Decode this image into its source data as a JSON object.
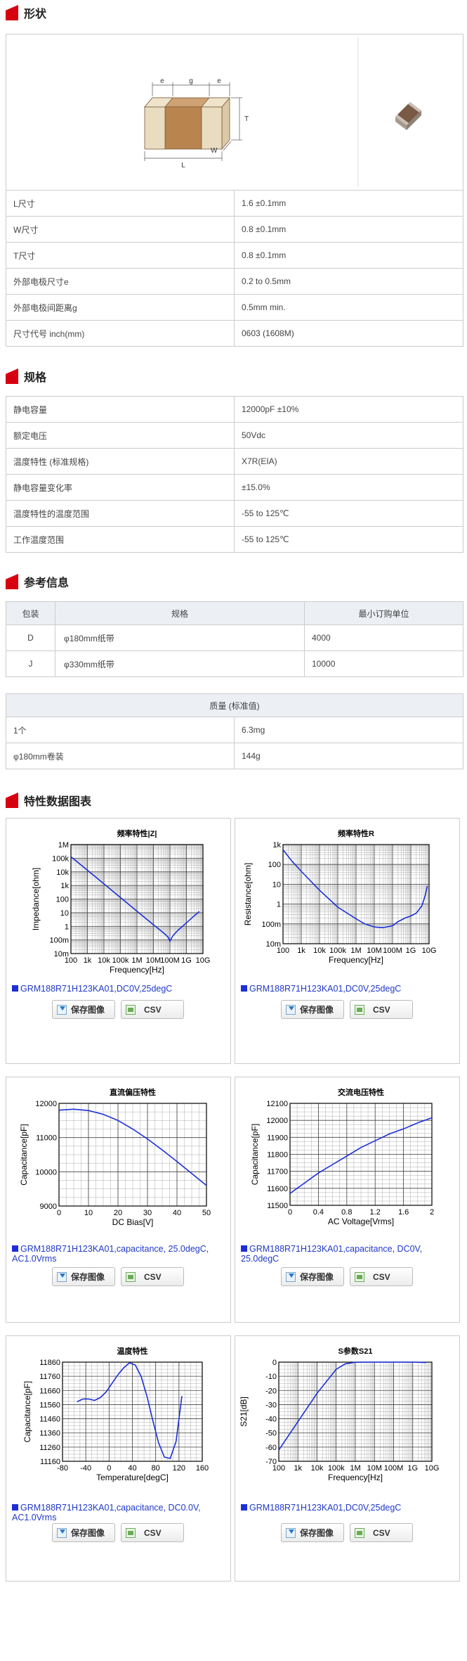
{
  "sections": {
    "shape": "形状",
    "spec": "规格",
    "ref": "参考信息",
    "charts": "特性数据图表"
  },
  "diagram": {
    "labels": {
      "e1": "e",
      "g": "g",
      "e2": "e",
      "T": "T",
      "W": "W",
      "L": "L"
    },
    "colors": {
      "body": "#b9844e",
      "electrode": "#e9dcc0",
      "photo_body": "#7a5a44"
    }
  },
  "shape_rows": [
    {
      "k": "L尺寸",
      "v": "1.6 ±0.1mm"
    },
    {
      "k": "W尺寸",
      "v": "0.8 ±0.1mm"
    },
    {
      "k": "T尺寸",
      "v": "0.8 ±0.1mm"
    },
    {
      "k": "外部电极尺寸e",
      "v": "0.2 to 0.5mm"
    },
    {
      "k": "外部电极间距离g",
      "v": "0.5mm min."
    },
    {
      "k": "尺寸代号 inch(mm)",
      "v": "0603 (1608M)"
    }
  ],
  "spec_rows": [
    {
      "k": "静电容量",
      "v": "12000pF ±10%"
    },
    {
      "k": "额定电压",
      "v": "50Vdc"
    },
    {
      "k": "温度特性 (标准规格)",
      "v": "X7R(EIA)"
    },
    {
      "k": "静电容量变化率",
      "v": "±15.0%"
    },
    {
      "k": "温度特性的温度范围",
      "v": "-55 to 125℃"
    },
    {
      "k": "工作温度范围",
      "v": "-55 to 125℃"
    }
  ],
  "pack": {
    "headers": [
      "包装",
      "规格",
      "最小订购单位"
    ],
    "rows": [
      {
        "a": "D",
        "b": "φ180mm纸带",
        "c": "4000"
      },
      {
        "a": "J",
        "b": "φ330mm纸带",
        "c": "10000"
      }
    ]
  },
  "mass": {
    "header": "质量 (标准值)",
    "rows": [
      {
        "k": "1个",
        "v": "6.3mg"
      },
      {
        "k": "φ180mm卷装",
        "v": "144g"
      }
    ]
  },
  "buttons": {
    "save": "保存图像",
    "csv": "CSV"
  },
  "series_color": "#1c2fd8",
  "chart_data": [
    {
      "type": "line",
      "title": "频率特性|Z|",
      "xlabel": "Frequency[Hz]",
      "ylabel": "Impedance[ohm]",
      "xscale": "log",
      "yscale": "log",
      "xlim": [
        100,
        10000000000
      ],
      "ylim": [
        0.01,
        1000000
      ],
      "xticks": [
        "100",
        "1k",
        "10k",
        "100k",
        "1M",
        "10M",
        "100M",
        "1G",
        "10G"
      ],
      "yticks": [
        "1M",
        "100k",
        "10k",
        "1k",
        "100",
        "10",
        "1",
        "100m",
        "10m"
      ],
      "grid": true,
      "legend": "GRM188R71H123KA01,DC0V,25degC",
      "series": [
        {
          "x": [
            100,
            1000,
            10000,
            100000,
            1000000,
            10000000,
            30000000,
            60000000,
            80000000,
            100000000,
            150000000,
            300000000,
            1000000000,
            3000000000,
            6000000000
          ],
          "y": [
            130000,
            13000,
            1300,
            130,
            13,
            1.3,
            0.45,
            0.22,
            0.15,
            0.08,
            0.2,
            0.5,
            1.8,
            6,
            12
          ]
        }
      ]
    },
    {
      "type": "line",
      "title": "频率特性R",
      "xlabel": "Frequency[Hz]",
      "ylabel": "Resistance[ohm]",
      "xscale": "log",
      "yscale": "log",
      "xlim": [
        100,
        10000000000
      ],
      "ylim": [
        0.01,
        1000
      ],
      "xticks": [
        "100",
        "1k",
        "10k",
        "100k",
        "1M",
        "10M",
        "100M",
        "1G",
        "10G"
      ],
      "yticks": [
        "1k",
        "100",
        "10",
        "1",
        "100m",
        "10m"
      ],
      "grid": true,
      "legend": "GRM188R71H123KA01,DC0V,25degC",
      "series": [
        {
          "x": [
            100,
            300,
            1000,
            10000,
            100000,
            1000000,
            3000000,
            10000000,
            30000000,
            100000000,
            200000000,
            500000000,
            1000000000,
            2000000000,
            4000000000,
            6000000000,
            8000000000
          ],
          "y": [
            550,
            150,
            45,
            5,
            0.7,
            0.18,
            0.1,
            0.07,
            0.065,
            0.08,
            0.13,
            0.2,
            0.25,
            0.35,
            0.8,
            2.5,
            8
          ]
        }
      ]
    },
    {
      "type": "line",
      "title": "直流偏压特性",
      "xlabel": "DC Bias[V]",
      "ylabel": "Capacitance[pF]",
      "xlim": [
        0,
        50
      ],
      "ylim": [
        9000,
        12000
      ],
      "xticks": [
        "0",
        "10",
        "20",
        "30",
        "40",
        "50"
      ],
      "yticks": [
        "12000",
        "11000",
        "10000",
        "9000"
      ],
      "grid": true,
      "legend": "GRM188R71H123KA01,capacitance, 25.0degC, AC1.0Vrms",
      "series": [
        {
          "x": [
            0,
            5,
            10,
            15,
            20,
            25,
            30,
            35,
            40,
            45,
            50
          ],
          "y": [
            11800,
            11830,
            11790,
            11680,
            11500,
            11250,
            10960,
            10640,
            10300,
            9950,
            9600
          ]
        }
      ]
    },
    {
      "type": "line",
      "title": "交流电压特性",
      "xlabel": "AC Voltage[Vrms]",
      "ylabel": "Capacitance[pF]",
      "xlim": [
        0,
        2
      ],
      "ylim": [
        11500,
        12100
      ],
      "xticks": [
        "0",
        "0.4",
        "0.8",
        "1.2",
        "1.6",
        "2"
      ],
      "yticks": [
        "12100",
        "12000",
        "11900",
        "11800",
        "11700",
        "11600",
        "11500"
      ],
      "grid": true,
      "legend": "GRM188R71H123KA01,capacitance, DC0V, 25.0degC",
      "series": [
        {
          "x": [
            0,
            0.2,
            0.4,
            0.6,
            0.8,
            1.0,
            1.2,
            1.4,
            1.6,
            1.8,
            2.0
          ],
          "y": [
            11570,
            11630,
            11690,
            11740,
            11790,
            11840,
            11880,
            11920,
            11950,
            11985,
            12015
          ]
        }
      ]
    },
    {
      "type": "line",
      "title": "温度特性",
      "xlabel": "Temperature[degC]",
      "ylabel": "Capacitance[pF]",
      "xlim": [
        -80,
        160
      ],
      "ylim": [
        11160,
        11860
      ],
      "xticks": [
        "-80",
        "-40",
        "0",
        "40",
        "80",
        "120",
        "160"
      ],
      "yticks": [
        "11860",
        "11760",
        "11660",
        "11560",
        "11460",
        "11360",
        "11260",
        "11160"
      ],
      "grid": true,
      "legend": "GRM188R71H123KA01,capacitance, DC0.0V, AC1.0Vrms",
      "series": [
        {
          "x": [
            -55,
            -45,
            -35,
            -25,
            -15,
            -5,
            5,
            15,
            25,
            35,
            45,
            55,
            65,
            75,
            85,
            95,
            105,
            115,
            125
          ],
          "y": [
            11580,
            11600,
            11600,
            11590,
            11610,
            11650,
            11710,
            11770,
            11820,
            11855,
            11840,
            11760,
            11620,
            11450,
            11290,
            11190,
            11180,
            11300,
            11620
          ]
        }
      ]
    },
    {
      "type": "line",
      "title": "S参数S21",
      "xlabel": "Frequency[Hz]",
      "ylabel": "S21[dB]",
      "xscale": "log",
      "xlim": [
        100,
        10000000000
      ],
      "ylim": [
        -70,
        0
      ],
      "xticks": [
        "100",
        "1k",
        "10k",
        "100k",
        "1M",
        "10M",
        "100M",
        "1G",
        "10G"
      ],
      "yticks": [
        "0",
        "-10",
        "-20",
        "-30",
        "-40",
        "-50",
        "-60",
        "-70"
      ],
      "grid": true,
      "legend": "GRM188R71H123KA01,DC0V,25degC",
      "series": [
        {
          "x": [
            100,
            1000,
            10000,
            100000,
            300000,
            1000000,
            3000000,
            10000000,
            100000000,
            1000000000,
            5000000000
          ],
          "y": [
            -62,
            -42,
            -22,
            -5,
            -1.2,
            -0.1,
            0,
            0,
            0,
            0,
            -0.3
          ]
        }
      ]
    }
  ]
}
